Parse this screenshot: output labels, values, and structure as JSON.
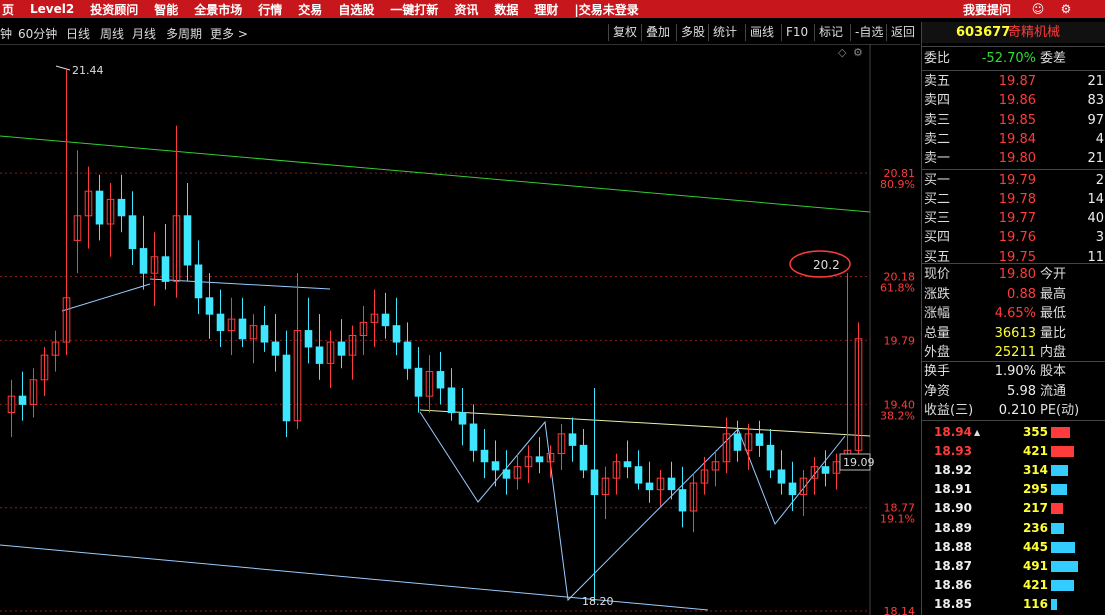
{
  "menu": {
    "items": [
      "页",
      "Level2",
      "投资顾问",
      "智能",
      "全景市场",
      "行情",
      "交易",
      "自选股",
      "一键打新",
      "资讯",
      "数据",
      "理财",
      "|交易未登录"
    ],
    "right_label": "我要提问"
  },
  "toolbar": {
    "periods": [
      "钟",
      "60分钟",
      "日线",
      "周线",
      "月线",
      "多周期",
      "更多 >"
    ],
    "buttons": [
      "复权",
      "叠加",
      "多股",
      "统计",
      "画线",
      "F10",
      "标记",
      "-自选",
      "返回"
    ]
  },
  "stock": {
    "code": "603677",
    "name": "奇精机械"
  },
  "quote": {
    "ratio_label": "委比",
    "ratio_value": "-52.70%",
    "diff_label": "委差",
    "asks": [
      {
        "label": "卖五",
        "price": "19.87",
        "vol": "21"
      },
      {
        "label": "卖四",
        "price": "19.86",
        "vol": "83"
      },
      {
        "label": "卖三",
        "price": "19.85",
        "vol": "97"
      },
      {
        "label": "卖二",
        "price": "19.84",
        "vol": "4"
      },
      {
        "label": "卖一",
        "price": "19.80",
        "vol": "21"
      }
    ],
    "bids": [
      {
        "label": "买一",
        "price": "19.79",
        "vol": "2"
      },
      {
        "label": "买二",
        "price": "19.78",
        "vol": "14"
      },
      {
        "label": "买三",
        "price": "19.77",
        "vol": "40"
      },
      {
        "label": "买四",
        "price": "19.76",
        "vol": "3"
      },
      {
        "label": "买五",
        "price": "19.75",
        "vol": "11"
      }
    ],
    "stats": [
      {
        "label": "现价",
        "value": "19.80",
        "label2": "今开"
      },
      {
        "label": "涨跌",
        "value": "0.88",
        "label2": "最高"
      },
      {
        "label": "涨幅",
        "value": "4.65%",
        "label2": "最低"
      },
      {
        "label": "总量",
        "value": "36613",
        "label2": "量比"
      },
      {
        "label": "外盘",
        "value": "25211",
        "label2": "内盘"
      }
    ],
    "stats2": [
      {
        "label": "换手",
        "value": "1.90%",
        "label2": "股本"
      },
      {
        "label": "净资",
        "value": "5.98",
        "label2": "流通"
      },
      {
        "label": "收益(三)",
        "value": "0.210",
        "label2": "PE(动)"
      }
    ]
  },
  "ticks": [
    {
      "price": "18.94",
      "vol": "355",
      "marker": "▲",
      "fill": 0.45,
      "color": "#ff3b3b"
    },
    {
      "price": "18.93",
      "vol": "421",
      "fill": 0.55,
      "color": "#ff3b3b"
    },
    {
      "price": "18.92",
      "vol": "314",
      "fill": 0.4,
      "color": "#33ccff"
    },
    {
      "price": "18.91",
      "vol": "295",
      "fill": 0.38,
      "color": "#33ccff"
    },
    {
      "price": "18.90",
      "vol": "217",
      "fill": 0.28,
      "color": "#ff3b3b"
    },
    {
      "price": "18.89",
      "vol": "236",
      "fill": 0.3,
      "color": "#33ccff"
    },
    {
      "price": "18.88",
      "vol": "445",
      "fill": 0.58,
      "color": "#33ccff"
    },
    {
      "price": "18.87",
      "vol": "491",
      "fill": 0.64,
      "color": "#33ccff"
    },
    {
      "price": "18.86",
      "vol": "421",
      "fill": 0.55,
      "color": "#33ccff"
    },
    {
      "price": "18.85",
      "vol": "116",
      "fill": 0.15,
      "color": "#33ccff"
    }
  ],
  "chart_data": {
    "type": "candlestick",
    "y_ticks": [
      {
        "value": "20.81",
        "pct": "80.9%"
      },
      {
        "value": "20.18",
        "pct": "61.8%"
      },
      {
        "value": "19.79",
        "pct": ""
      },
      {
        "value": "19.40",
        "pct": "38.2%"
      },
      {
        "value": "18.77",
        "pct": "19.1%"
      },
      {
        "value": "18.14",
        "pct": ""
      }
    ],
    "annotations": {
      "high": "21.44",
      "low": "18.20",
      "circled": "20.2",
      "current": "19.09"
    },
    "up_color": "#ff3b3b",
    "down_color": "#3ee6ff",
    "ylim": [
      18.14,
      21.5
    ],
    "candles": [
      [
        19.35,
        19.55,
        19.2,
        19.45
      ],
      [
        19.45,
        19.6,
        19.3,
        19.4
      ],
      [
        19.4,
        19.62,
        19.32,
        19.55
      ],
      [
        19.55,
        19.75,
        19.45,
        19.7
      ],
      [
        19.7,
        19.85,
        19.6,
        19.78
      ],
      [
        19.78,
        21.44,
        19.7,
        20.05
      ],
      [
        20.4,
        20.95,
        20.2,
        20.55
      ],
      [
        20.55,
        20.85,
        20.35,
        20.7
      ],
      [
        20.7,
        20.8,
        20.4,
        20.5
      ],
      [
        20.5,
        20.75,
        20.3,
        20.65
      ],
      [
        20.65,
        20.8,
        20.45,
        20.55
      ],
      [
        20.55,
        20.7,
        20.25,
        20.35
      ],
      [
        20.35,
        20.55,
        20.1,
        20.2
      ],
      [
        20.2,
        20.45,
        20.0,
        20.3
      ],
      [
        20.3,
        20.5,
        20.1,
        20.15
      ],
      [
        20.15,
        21.1,
        20.05,
        20.55
      ],
      [
        20.55,
        20.75,
        20.15,
        20.25
      ],
      [
        20.25,
        20.4,
        19.95,
        20.05
      ],
      [
        20.05,
        20.2,
        19.8,
        19.95
      ],
      [
        19.95,
        20.1,
        19.75,
        19.85
      ],
      [
        19.85,
        20.05,
        19.7,
        19.92
      ],
      [
        19.92,
        20.05,
        19.75,
        19.8
      ],
      [
        19.8,
        19.95,
        19.65,
        19.88
      ],
      [
        19.88,
        20.0,
        19.72,
        19.78
      ],
      [
        19.78,
        19.95,
        19.6,
        19.7
      ],
      [
        19.7,
        19.85,
        19.2,
        19.3
      ],
      [
        19.3,
        20.2,
        19.25,
        19.85
      ],
      [
        19.85,
        20.05,
        19.65,
        19.75
      ],
      [
        19.75,
        19.95,
        19.55,
        19.65
      ],
      [
        19.65,
        19.85,
        19.5,
        19.78
      ],
      [
        19.78,
        19.92,
        19.62,
        19.7
      ],
      [
        19.7,
        19.88,
        19.55,
        19.82
      ],
      [
        19.82,
        20.0,
        19.7,
        19.9
      ],
      [
        19.9,
        20.1,
        19.75,
        19.95
      ],
      [
        19.95,
        20.08,
        19.8,
        19.88
      ],
      [
        19.88,
        20.05,
        19.7,
        19.78
      ],
      [
        19.78,
        19.9,
        19.55,
        19.62
      ],
      [
        19.62,
        19.75,
        19.35,
        19.45
      ],
      [
        19.45,
        19.7,
        19.35,
        19.6
      ],
      [
        19.6,
        19.72,
        19.4,
        19.5
      ],
      [
        19.5,
        19.62,
        19.3,
        19.35
      ],
      [
        19.35,
        19.5,
        19.15,
        19.28
      ],
      [
        19.28,
        19.4,
        19.05,
        19.12
      ],
      [
        19.12,
        19.25,
        18.95,
        19.05
      ],
      [
        19.05,
        19.18,
        18.9,
        19.0
      ],
      [
        19.0,
        19.12,
        18.85,
        18.95
      ],
      [
        18.95,
        19.1,
        18.88,
        19.02
      ],
      [
        19.02,
        19.15,
        18.92,
        19.08
      ],
      [
        19.08,
        19.2,
        18.98,
        19.05
      ],
      [
        19.05,
        19.15,
        18.95,
        19.1
      ],
      [
        19.1,
        19.28,
        19.0,
        19.22
      ],
      [
        19.22,
        19.32,
        19.05,
        19.15
      ],
      [
        19.15,
        19.25,
        18.95,
        19.0
      ],
      [
        19.0,
        19.5,
        18.2,
        18.85
      ],
      [
        18.85,
        19.02,
        18.7,
        18.95
      ],
      [
        18.95,
        19.1,
        18.85,
        19.05
      ],
      [
        19.05,
        19.18,
        18.95,
        19.02
      ],
      [
        19.02,
        19.12,
        18.88,
        18.92
      ],
      [
        18.92,
        19.05,
        18.8,
        18.88
      ],
      [
        18.88,
        19.0,
        18.78,
        18.95
      ],
      [
        18.95,
        19.05,
        18.82,
        18.88
      ],
      [
        18.88,
        19.02,
        18.65,
        18.75
      ],
      [
        18.75,
        18.98,
        18.62,
        18.92
      ],
      [
        18.92,
        19.08,
        18.85,
        19.0
      ],
      [
        19.0,
        19.12,
        18.9,
        19.05
      ],
      [
        19.05,
        19.32,
        18.98,
        19.22
      ],
      [
        19.22,
        19.3,
        19.05,
        19.12
      ],
      [
        19.12,
        19.28,
        19.0,
        19.22
      ],
      [
        19.22,
        19.3,
        19.08,
        19.15
      ],
      [
        19.15,
        19.25,
        18.95,
        19.0
      ],
      [
        19.0,
        19.12,
        18.85,
        18.92
      ],
      [
        18.92,
        19.05,
        18.75,
        18.85
      ],
      [
        18.85,
        19.0,
        18.72,
        18.95
      ],
      [
        18.95,
        19.08,
        18.85,
        19.02
      ],
      [
        19.02,
        19.12,
        18.9,
        18.98
      ],
      [
        18.98,
        19.1,
        18.88,
        19.05
      ],
      [
        19.05,
        20.2,
        19.0,
        19.12
      ],
      [
        19.12,
        19.9,
        19.05,
        19.8
      ]
    ]
  }
}
